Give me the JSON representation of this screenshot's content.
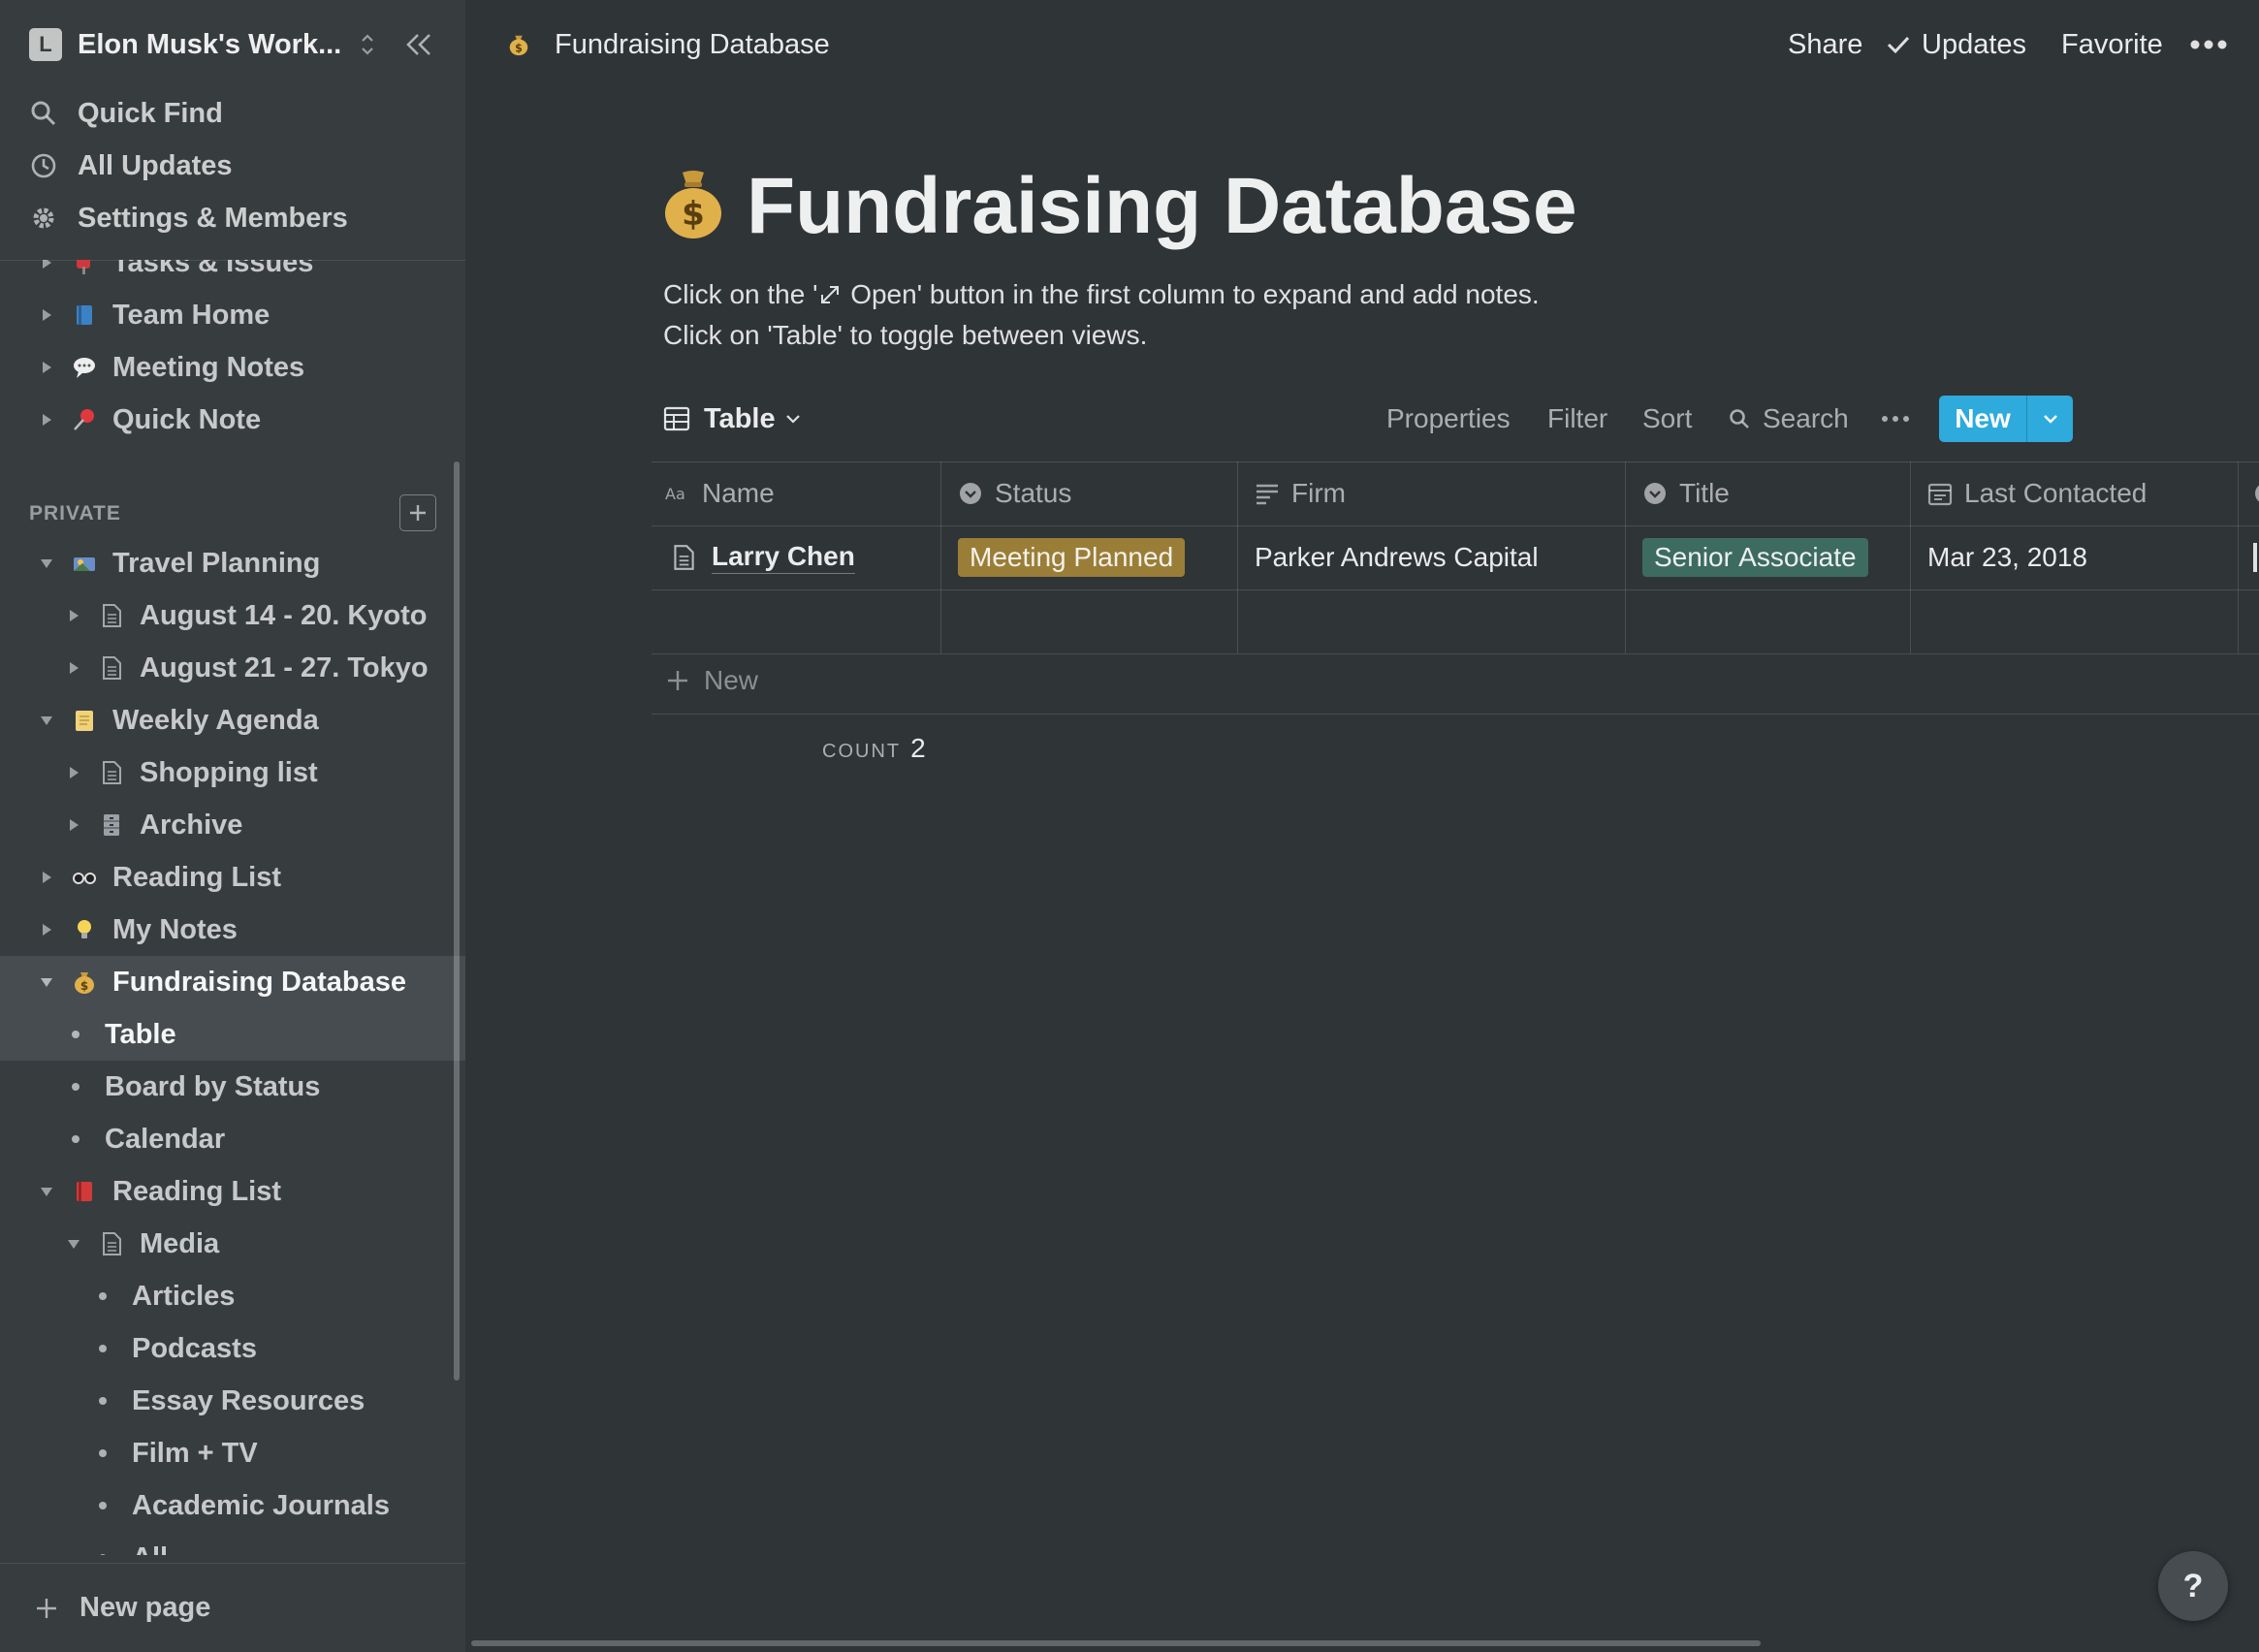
{
  "sidebar": {
    "workspace": {
      "avatar_letter": "L",
      "name": "Elon Musk's Work..."
    },
    "top_items": [
      {
        "label": "Quick Find",
        "icon": "search-icon"
      },
      {
        "label": "All Updates",
        "icon": "clock-icon"
      },
      {
        "label": "Settings & Members",
        "icon": "gear-icon"
      }
    ],
    "workspace_pages": [
      {
        "label": "Tasks & Issues",
        "icon": "mailbox-icon"
      },
      {
        "label": "Team Home",
        "icon": "blue-book-icon"
      },
      {
        "label": "Meeting Notes",
        "icon": "speech-bubble-icon"
      },
      {
        "label": "Quick Note",
        "icon": "pushpin-icon"
      }
    ],
    "private_label": "PRIVATE",
    "private_pages": [
      {
        "label": "Travel Planning",
        "icon": "travel-icon"
      },
      {
        "label": "August 14 - 20. Kyoto",
        "icon": "page-icon"
      },
      {
        "label": "August 21 - 27. Tokyo",
        "icon": "page-icon"
      },
      {
        "label": "Weekly Agenda",
        "icon": "notepad-icon"
      },
      {
        "label": "Shopping list",
        "icon": "page-icon"
      },
      {
        "label": "Archive",
        "icon": "cabinet-icon"
      },
      {
        "label": "Reading List",
        "icon": "glasses-icon"
      },
      {
        "label": "My Notes",
        "icon": "lightbulb-icon"
      },
      {
        "label": "Fundraising Database",
        "icon": "money-bag-icon"
      },
      {
        "label": "Table"
      },
      {
        "label": "Board by Status"
      },
      {
        "label": "Calendar"
      },
      {
        "label": "Reading List",
        "icon": "red-book-icon"
      },
      {
        "label": "Media",
        "icon": "page-icon"
      },
      {
        "label": "Articles"
      },
      {
        "label": "Podcasts"
      },
      {
        "label": "Essay Resources"
      },
      {
        "label": "Film + TV"
      },
      {
        "label": "Academic Journals"
      },
      {
        "label": "All"
      }
    ],
    "new_page_label": "New page"
  },
  "topbar": {
    "breadcrumb": "Fundraising Database",
    "share": "Share",
    "updates": "Updates",
    "favorite": "Favorite"
  },
  "page": {
    "title": "Fundraising Database",
    "description_line1_prefix": "Click on the '",
    "description_line1_suffix": " Open' button in the first column to expand and add notes.",
    "description_line2": "Click on 'Table' to toggle between views."
  },
  "toolbar": {
    "view_label": "Table",
    "properties": "Properties",
    "filter": "Filter",
    "sort": "Sort",
    "search": "Search",
    "new_button": "New"
  },
  "table": {
    "columns": [
      {
        "label": "Name",
        "icon": "text-icon"
      },
      {
        "label": "Status",
        "icon": "select-icon"
      },
      {
        "label": "Firm",
        "icon": "lines-icon"
      },
      {
        "label": "Title",
        "icon": "select-icon"
      },
      {
        "label": "Last Contacted",
        "icon": "calendar-icon"
      }
    ],
    "rows": [
      {
        "name": "Larry Chen",
        "status": "Meeting Planned",
        "firm": "Parker Andrews Capital",
        "title": "Senior Associate",
        "last_contacted": "Mar 23, 2018"
      }
    ],
    "add_row_label": "New",
    "count_label": "COUNT",
    "count_value": "2"
  },
  "colors": {
    "status_meeting_planned": "#9a7e38",
    "title_senior_associate": "#3d6b5f",
    "accent": "#2eaadc"
  },
  "help_label": "?"
}
